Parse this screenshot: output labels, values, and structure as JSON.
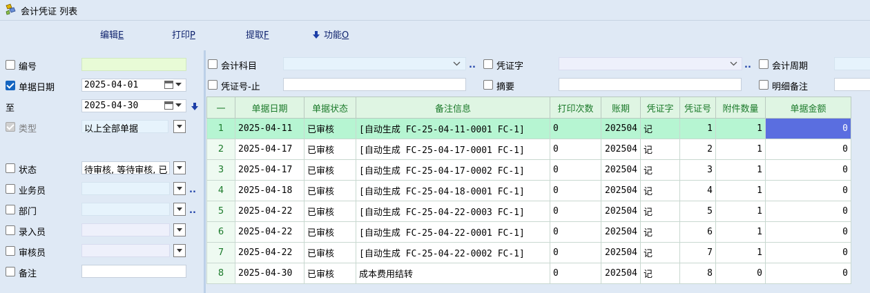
{
  "window": {
    "title": "会计凭证 列表"
  },
  "toolbar": [
    {
      "label": "编辑",
      "key": "E",
      "icon": ""
    },
    {
      "label": "打印",
      "key": "P",
      "icon": ""
    },
    {
      "label": "提取",
      "key": "F",
      "icon": ""
    },
    {
      "label": "功能",
      "key": "O",
      "icon": "arrow-down-icon"
    }
  ],
  "left": {
    "number": {
      "label": "编号",
      "checked": false,
      "value": ""
    },
    "doc_date": {
      "label": "单据日期",
      "checked": true,
      "from": "2025-04-01"
    },
    "to": {
      "label": "至",
      "value": "2025-04-30"
    },
    "type": {
      "label": "类型",
      "checked": true,
      "disabled": true,
      "value": "以上全部单据"
    },
    "status": {
      "label": "状态",
      "checked": false,
      "value": "待审核, 等待审核, 已"
    },
    "salesman": {
      "label": "业务员",
      "checked": false,
      "value": ""
    },
    "department": {
      "label": "部门",
      "checked": false,
      "value": ""
    },
    "entry_clerk": {
      "label": "录入员",
      "checked": false,
      "value": ""
    },
    "auditor": {
      "label": "审核员",
      "checked": false,
      "value": ""
    },
    "remark": {
      "label": "备注",
      "checked": false,
      "value": ""
    }
  },
  "filters": {
    "account_subject": {
      "label": "会计科目",
      "value": ""
    },
    "voucher_word": {
      "label": "凭证字",
      "value": ""
    },
    "account_period": {
      "label": "会计周期",
      "value": ""
    },
    "voucher_no_end": {
      "label": "凭证号-止",
      "value": ""
    },
    "summary": {
      "label": "摘要",
      "value": ""
    },
    "detail_remark": {
      "label": "明细备注",
      "value": ""
    }
  },
  "grid": {
    "corner": "一",
    "columns": [
      "单据日期",
      "单据状态",
      "备注信息",
      "打印次数",
      "账期",
      "凭证字",
      "凭证号",
      "附件数量",
      "单据金额"
    ],
    "rows": [
      {
        "idx": "1",
        "date": "2025-04-11",
        "status": "已审核",
        "remark": "[自动生成 FC-25-04-11-0001 FC-1]",
        "prints": "0",
        "period": "202504",
        "word": "记",
        "no": "1",
        "attach": "1",
        "amount": "0"
      },
      {
        "idx": "2",
        "date": "2025-04-17",
        "status": "已审核",
        "remark": "[自动生成 FC-25-04-17-0001 FC-1]",
        "prints": "0",
        "period": "202504",
        "word": "记",
        "no": "2",
        "attach": "1",
        "amount": "0"
      },
      {
        "idx": "3",
        "date": "2025-04-17",
        "status": "已审核",
        "remark": "[自动生成 FC-25-04-17-0002 FC-1]",
        "prints": "0",
        "period": "202504",
        "word": "记",
        "no": "3",
        "attach": "1",
        "amount": "0"
      },
      {
        "idx": "4",
        "date": "2025-04-18",
        "status": "已审核",
        "remark": "[自动生成 FC-25-04-18-0001 FC-1]",
        "prints": "0",
        "period": "202504",
        "word": "记",
        "no": "4",
        "attach": "1",
        "amount": "0"
      },
      {
        "idx": "5",
        "date": "2025-04-22",
        "status": "已审核",
        "remark": "[自动生成 FC-25-04-22-0003 FC-1]",
        "prints": "0",
        "period": "202504",
        "word": "记",
        "no": "5",
        "attach": "1",
        "amount": "0"
      },
      {
        "idx": "6",
        "date": "2025-04-22",
        "status": "已审核",
        "remark": "[自动生成 FC-25-04-22-0001 FC-1]",
        "prints": "0",
        "period": "202504",
        "word": "记",
        "no": "6",
        "attach": "1",
        "amount": "0"
      },
      {
        "idx": "7",
        "date": "2025-04-22",
        "status": "已审核",
        "remark": "[自动生成 FC-25-04-22-0002 FC-1]",
        "prints": "0",
        "period": "202504",
        "word": "记",
        "no": "7",
        "attach": "1",
        "amount": "0"
      },
      {
        "idx": "8",
        "date": "2025-04-30",
        "status": "已审核",
        "remark": "成本费用结转",
        "prints": "0",
        "period": "202504",
        "word": "记",
        "no": "8",
        "attach": "0",
        "amount": "0"
      }
    ]
  }
}
